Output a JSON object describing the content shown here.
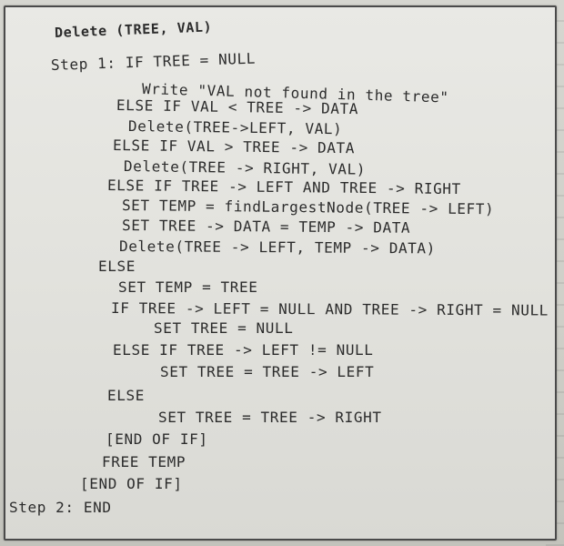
{
  "algorithm": {
    "header": "Delete (TREE, VAL)",
    "lines": [
      "Step 1: IF TREE = NULL",
      "Write \"VAL not found in the tree\"",
      "ELSE IF VAL < TREE -> DATA",
      "Delete(TREE->LEFT, VAL)",
      "ELSE IF VAL > TREE -> DATA",
      "Delete(TREE -> RIGHT, VAL)",
      "ELSE IF TREE -> LEFT AND TREE -> RIGHT",
      "SET TEMP = findLargestNode(TREE -> LEFT)",
      "SET TREE -> DATA = TEMP -> DATA",
      "Delete(TREE -> LEFT, TEMP -> DATA)",
      "ELSE",
      "SET TEMP = TREE",
      "IF TREE -> LEFT = NULL AND TREE -> RIGHT = NULL",
      "SET TREE = NULL",
      "ELSE IF TREE -> LEFT != NULL",
      "SET TREE = TREE -> LEFT",
      "ELSE",
      "SET TREE = TREE -> RIGHT",
      "[END OF IF]",
      "FREE TEMP",
      "[END OF IF]",
      "Step 2: END"
    ]
  }
}
